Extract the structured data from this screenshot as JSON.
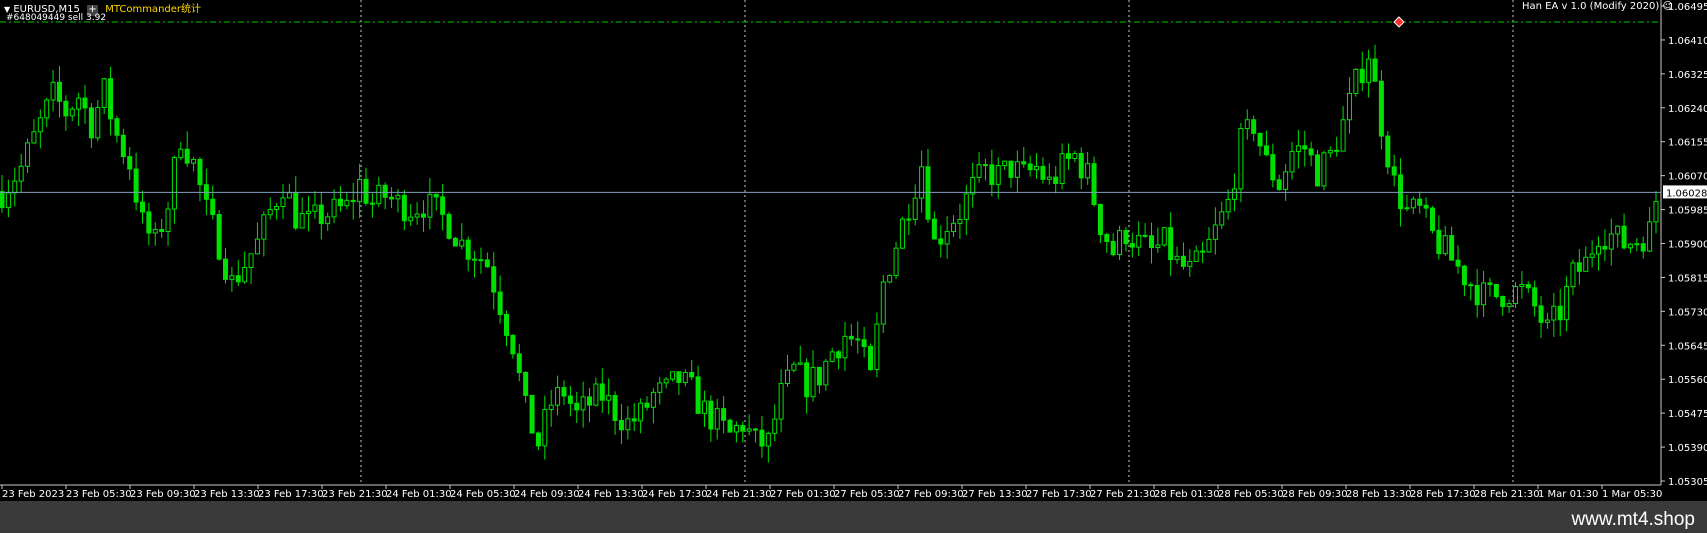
{
  "header": {
    "symbol": "EURUSD,M15",
    "plus": "+",
    "indicator": "MTCommander统计",
    "order": "#648049449 sell 3.92",
    "ea": "Han EA  v 1.0 (Modify 2020)",
    "smiley": "☺"
  },
  "watermark": "www.mt4.shop",
  "colors": {
    "candle": "#00e000",
    "current_line": "#7f9fbf",
    "order_line": "#00c800",
    "grid": "#ffffff",
    "bg": "#000000"
  },
  "chart_data": {
    "type": "line",
    "symbol": "EURUSD",
    "timeframe": "M15",
    "current_price": "1.06028",
    "order_price": 1.06455,
    "ylim": [
      1.053,
      1.065
    ],
    "yticks": [
      "1.06495",
      "1.06410",
      "1.06325",
      "1.06240",
      "1.06155",
      "1.06070",
      "1.05985",
      "1.05900",
      "1.05815",
      "1.05730",
      "1.05645",
      "1.05560",
      "1.05475",
      "1.05390",
      "1.05305"
    ],
    "xticks": [
      "23 Feb 2023",
      "23 Feb 05:30",
      "23 Feb 09:30",
      "23 Feb 13:30",
      "23 Feb 17:30",
      "23 Feb 21:30",
      "24 Feb 01:30",
      "24 Feb 05:30",
      "24 Feb 09:30",
      "24 Feb 13:30",
      "24 Feb 17:30",
      "24 Feb 21:30",
      "27 Feb 01:30",
      "27 Feb 05:30",
      "27 Feb 09:30",
      "27 Feb 13:30",
      "27 Feb 17:30",
      "27 Feb 21:30",
      "28 Feb 01:30",
      "28 Feb 05:30",
      "28 Feb 09:30",
      "28 Feb 13:30",
      "28 Feb 17:30",
      "28 Feb 21:30",
      "1 Mar 01:30",
      "1 Mar 05:30"
    ],
    "day_separators": [
      "24 Feb",
      "27 Feb",
      "28 Feb",
      "1 Mar"
    ],
    "price_path": [
      [
        0,
        1.0603
      ],
      [
        3,
        1.0609
      ],
      [
        6,
        1.062
      ],
      [
        8,
        1.0627
      ],
      [
        10,
        1.0623
      ],
      [
        12,
        1.0627
      ],
      [
        14,
        1.062
      ],
      [
        16,
        1.0628
      ],
      [
        18,
        1.0617
      ],
      [
        20,
        1.061
      ],
      [
        22,
        1.0595
      ],
      [
        24,
        1.059
      ],
      [
        26,
        1.06
      ],
      [
        28,
        1.0617
      ],
      [
        30,
        1.061
      ],
      [
        32,
        1.0598
      ],
      [
        34,
        1.059
      ],
      [
        36,
        1.058
      ],
      [
        38,
        1.0585
      ],
      [
        40,
        1.059
      ],
      [
        42,
        1.0598
      ],
      [
        44,
        1.0605
      ],
      [
        46,
        1.0597
      ],
      [
        48,
        1.0595
      ],
      [
        50,
        1.0597
      ],
      [
        52,
        1.0598
      ],
      [
        54,
        1.0599
      ],
      [
        56,
        1.0605
      ],
      [
        58,
        1.06
      ],
      [
        60,
        1.0602
      ],
      [
        62,
        1.06
      ],
      [
        64,
        1.0599
      ],
      [
        66,
        1.06
      ],
      [
        68,
        1.0598
      ],
      [
        70,
        1.0595
      ],
      [
        72,
        1.059
      ],
      [
        74,
        1.0588
      ],
      [
        76,
        1.0585
      ],
      [
        78,
        1.0575
      ],
      [
        80,
        1.0565
      ],
      [
        82,
        1.0548
      ],
      [
        84,
        1.054
      ],
      [
        86,
        1.055
      ],
      [
        88,
        1.0553
      ],
      [
        90,
        1.0547
      ],
      [
        92,
        1.055
      ],
      [
        94,
        1.0552
      ],
      [
        96,
        1.0548
      ],
      [
        98,
        1.0545
      ],
      [
        100,
        1.0547
      ],
      [
        102,
        1.0552
      ],
      [
        104,
        1.0553
      ],
      [
        106,
        1.0556
      ],
      [
        108,
        1.0553
      ],
      [
        110,
        1.0548
      ],
      [
        112,
        1.0545
      ],
      [
        114,
        1.0542
      ],
      [
        116,
        1.0545
      ],
      [
        118,
        1.054
      ],
      [
        120,
        1.054
      ],
      [
        122,
        1.0552
      ],
      [
        124,
        1.0558
      ],
      [
        126,
        1.0555
      ],
      [
        128,
        1.0557
      ],
      [
        130,
        1.0563
      ],
      [
        132,
        1.0567
      ],
      [
        134,
        1.0565
      ],
      [
        136,
        1.0556
      ],
      [
        138,
        1.058
      ],
      [
        140,
        1.059
      ],
      [
        142,
        1.06
      ],
      [
        144,
        1.061
      ],
      [
        146,
        1.059
      ],
      [
        148,
        1.0595
      ],
      [
        150,
        1.0598
      ],
      [
        152,
        1.0604
      ],
      [
        154,
        1.0608
      ],
      [
        156,
        1.0607
      ],
      [
        158,
        1.0609
      ],
      [
        160,
        1.0607
      ],
      [
        162,
        1.0609
      ],
      [
        164,
        1.0605
      ],
      [
        166,
        1.0609
      ],
      [
        168,
        1.0612
      ],
      [
        170,
        1.0607
      ],
      [
        172,
        1.0595
      ],
      [
        174,
        1.0588
      ],
      [
        176,
        1.0593
      ],
      [
        178,
        1.059
      ],
      [
        180,
        1.0588
      ],
      [
        182,
        1.059
      ],
      [
        184,
        1.0585
      ],
      [
        186,
        1.0583
      ],
      [
        188,
        1.0586
      ],
      [
        190,
        1.0593
      ],
      [
        192,
        1.06
      ],
      [
        194,
        1.0615
      ],
      [
        196,
        1.062
      ],
      [
        198,
        1.061
      ],
      [
        200,
        1.0605
      ],
      [
        202,
        1.0613
      ],
      [
        204,
        1.0614
      ],
      [
        206,
        1.0608
      ],
      [
        208,
        1.0612
      ],
      [
        210,
        1.062
      ],
      [
        212,
        1.063
      ],
      [
        214,
        1.0638
      ],
      [
        216,
        1.062
      ],
      [
        218,
        1.0605
      ],
      [
        220,
        1.0598
      ],
      [
        222,
        1.0598
      ],
      [
        224,
        1.0592
      ],
      [
        226,
        1.0588
      ],
      [
        228,
        1.0584
      ],
      [
        230,
        1.058
      ],
      [
        232,
        1.0577
      ],
      [
        234,
        1.0577
      ],
      [
        236,
        1.0578
      ],
      [
        238,
        1.0578
      ],
      [
        240,
        1.0574
      ],
      [
        242,
        1.0568
      ],
      [
        244,
        1.0573
      ],
      [
        246,
        1.0582
      ],
      [
        248,
        1.0585
      ],
      [
        250,
        1.0593
      ],
      [
        252,
        1.0592
      ],
      [
        254,
        1.059
      ],
      [
        256,
        1.0591
      ],
      [
        258,
        1.0593
      ],
      [
        259,
        1.0601
      ]
    ]
  }
}
